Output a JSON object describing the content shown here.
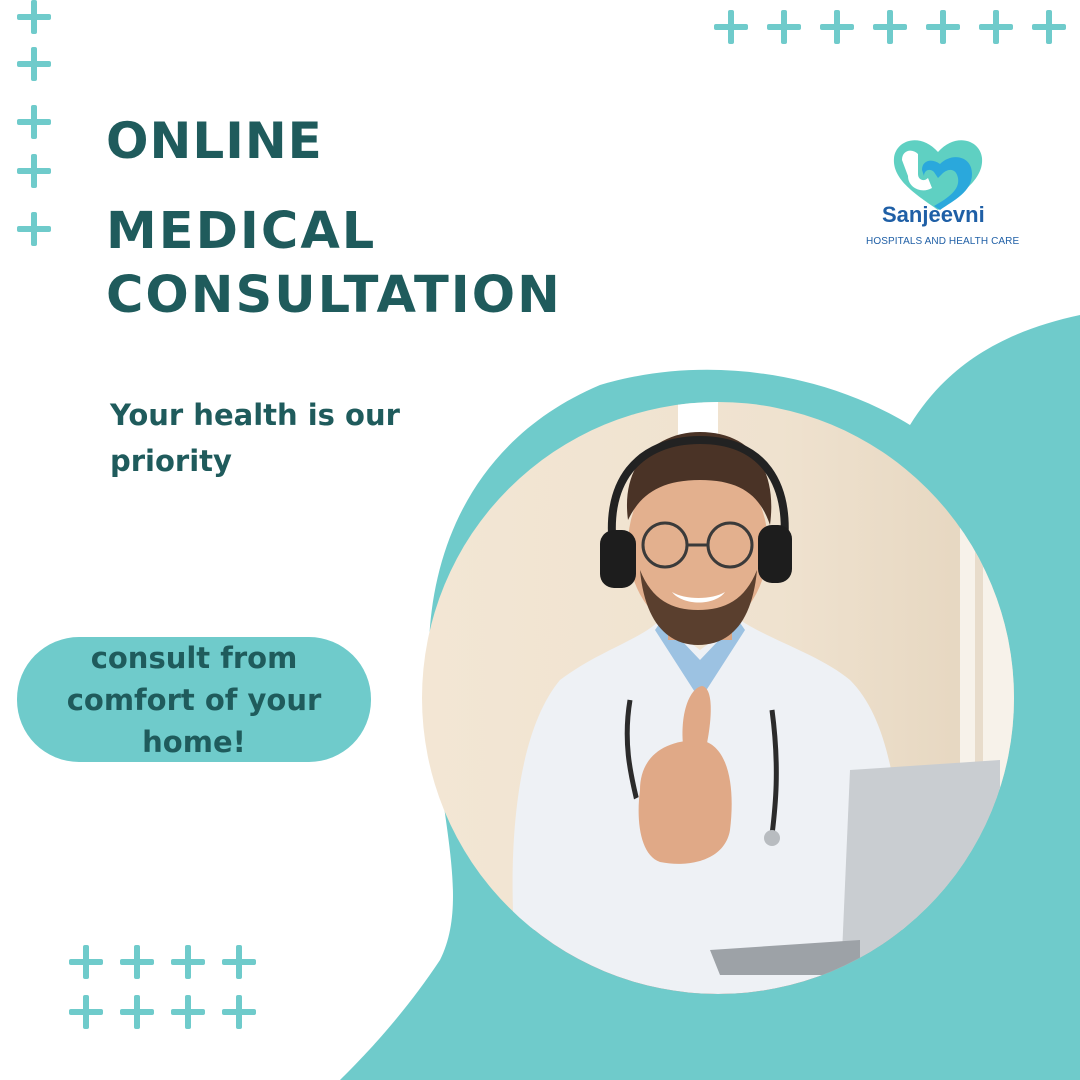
{
  "headline": {
    "line1": "ONLINE",
    "line2": "MEDICAL",
    "line3": "CONSULTATION"
  },
  "tagline": "Your health is our priority",
  "pill_text": "consult from comfort of your home!",
  "logo": {
    "name": "Sanjeevni",
    "subtitle": "HOSPITALS AND HEALTH CARE"
  },
  "photo": {
    "subject": "doctor-thumbs-up-with-headset-and-laptop"
  },
  "colors": {
    "teal": "#6fcbcb",
    "dark_teal": "#1f5b5c",
    "brand_blue": "#1f5fa6",
    "background": "#ffffff"
  }
}
